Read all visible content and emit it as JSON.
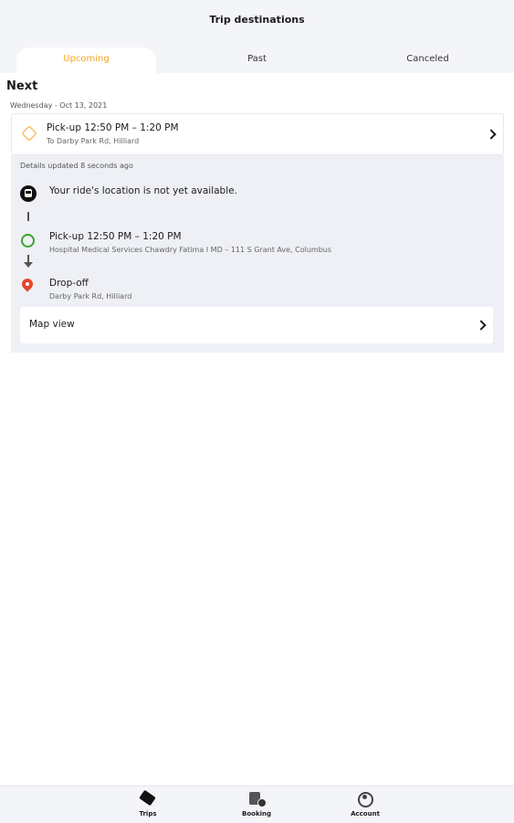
{
  "header": {
    "title": "Trip destinations",
    "tabs": [
      {
        "label": "Upcoming",
        "active": true
      },
      {
        "label": "Past",
        "active": false
      },
      {
        "label": "Canceled",
        "active": false
      }
    ]
  },
  "main": {
    "section_title": "Next",
    "date": "Wednesday - Oct 13, 2021",
    "trip": {
      "title": "Pick-up 12:50 PM – 1:20 PM",
      "subtitle": "To Darby Park Rd, Hilliard"
    },
    "details": {
      "updated_text": "Details updated 8 seconds ago",
      "location_status": "Your ride's location is not yet available.",
      "pickup": {
        "title": "Pick-up 12:50 PM – 1:20 PM",
        "address": "Hospital Medical Services Chawdry Fatima I MD – 111 S Grant Ave, Columbus"
      },
      "dropoff": {
        "title": "Drop-off",
        "address": "Darby Park Rd, Hilliard"
      },
      "map_view_label": "Map view"
    }
  },
  "bottom_nav": {
    "items": [
      {
        "label": "Trips",
        "icon": "ticket-icon"
      },
      {
        "label": "Booking",
        "icon": "booking-icon"
      },
      {
        "label": "Account",
        "icon": "account-icon"
      }
    ]
  },
  "colors": {
    "accent": "#f5a623",
    "pickup_green": "#3aa42a",
    "dropoff_red": "#e8452c",
    "panel_bg": "#eef0f6"
  }
}
